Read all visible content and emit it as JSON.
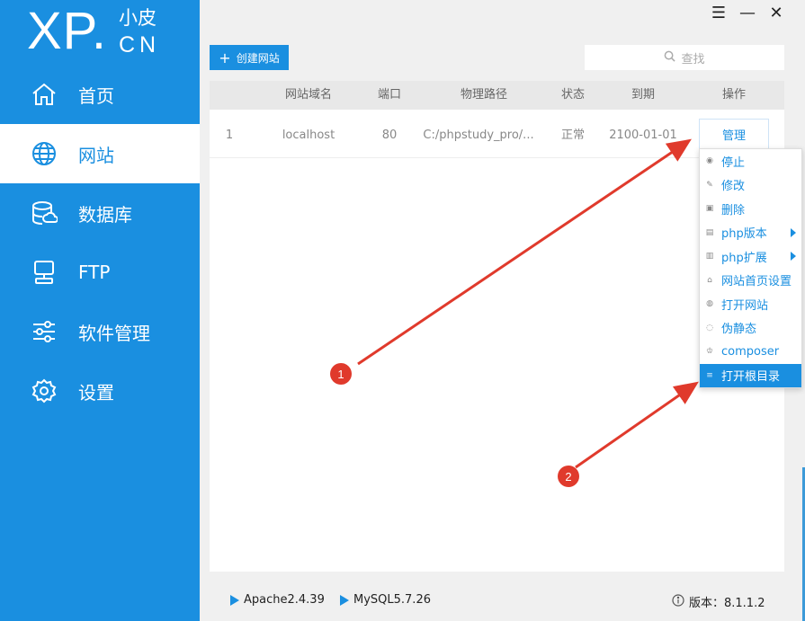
{
  "logo": {
    "main": "XP.",
    "sub_top": "小皮",
    "sub_bottom": "CN"
  },
  "nav": [
    {
      "label": "首页",
      "icon": "home-icon"
    },
    {
      "label": "网站",
      "icon": "globe-icon",
      "active": true
    },
    {
      "label": "数据库",
      "icon": "database-icon"
    },
    {
      "label": "FTP",
      "icon": "ftp-icon"
    },
    {
      "label": "软件管理",
      "icon": "sliders-icon"
    },
    {
      "label": "设置",
      "icon": "gear-icon"
    }
  ],
  "window_controls": {
    "menu": "☰",
    "minimize": "—",
    "close": "✕"
  },
  "toolbar": {
    "create_icon": "+",
    "create_label": "创建网站",
    "search_icon": "search-icon",
    "search_placeholder": "查找"
  },
  "table": {
    "headers": [
      "网站域名",
      "端口",
      "物理路径",
      "状态",
      "到期",
      "操作"
    ],
    "rows": [
      {
        "index": "1",
        "domain": "localhost",
        "port": "80",
        "path": "C:/phpstudy_pro/...",
        "status": "正常",
        "expire": "2100-01-01",
        "action": "管理"
      }
    ]
  },
  "context_menu": [
    {
      "label": "停止",
      "icon": "stop-icon"
    },
    {
      "label": "修改",
      "icon": "edit-icon"
    },
    {
      "label": "删除",
      "icon": "trash-icon"
    },
    {
      "label": "php版本",
      "icon": "php-version-icon",
      "submenu": true
    },
    {
      "label": "php扩展",
      "icon": "php-extension-icon",
      "submenu": true
    },
    {
      "label": "网站首页设置",
      "icon": "homepage-icon"
    },
    {
      "label": "打开网站",
      "icon": "open-site-icon"
    },
    {
      "label": "伪静态",
      "icon": "rewrite-icon"
    },
    {
      "label": "composer",
      "icon": "composer-icon"
    },
    {
      "label": "打开根目录",
      "icon": "folder-icon",
      "highlighted": true
    }
  ],
  "footer": {
    "apache": "Apache2.4.39",
    "mysql": "MySQL5.7.26",
    "version_label": "版本：8.1.1.2"
  },
  "annotations": [
    {
      "label": "1"
    },
    {
      "label": "2"
    }
  ],
  "colors": {
    "brand": "#1a8fe0",
    "annotation": "#e03a2c"
  }
}
